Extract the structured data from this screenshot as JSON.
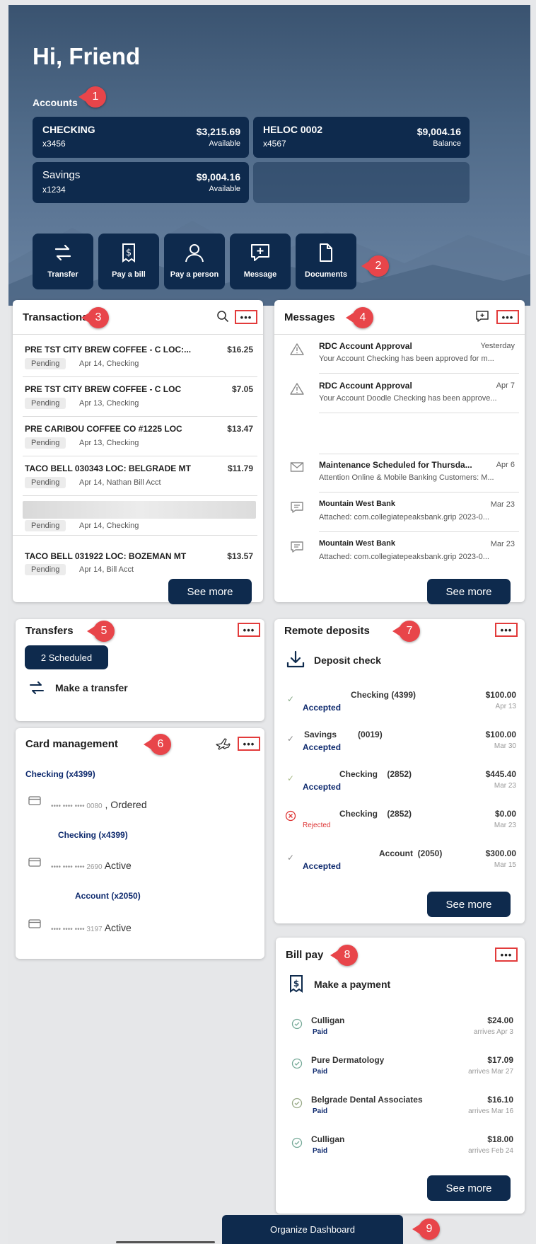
{
  "greeting": "Hi, Friend",
  "accounts_label": "Accounts",
  "accounts": [
    {
      "name": "CHECKING",
      "number": "x3456",
      "amount": "$3,215.69",
      "sub": "Available"
    },
    {
      "name": "HELOC 0002",
      "number": "x4567",
      "amount": "$9,004.16",
      "sub": "Balance"
    },
    {
      "name": "Savings",
      "number": "x1234",
      "amount": "$9,004.16",
      "sub": "Available"
    }
  ],
  "quick_actions": [
    "Transfer",
    "Pay a bill",
    "Pay a person",
    "Message",
    "Documents"
  ],
  "badges": [
    "1",
    "2",
    "3",
    "4",
    "5",
    "6",
    "7",
    "8",
    "9"
  ],
  "more_label": "•••",
  "transactions": {
    "title": "Transactions",
    "items": [
      {
        "desc": "PRE TST CITY BREW COFFEE - C LOC:...",
        "amount": "$16.25",
        "status": "Pending",
        "meta": "Apr 14, Checking"
      },
      {
        "desc": "PRE TST CITY BREW COFFEE - C LOC",
        "amount": "$7.05",
        "status": "Pending",
        "meta": "Apr 13, Checking"
      },
      {
        "desc": "PRE CARIBOU COFFEE CO #1225 LOC",
        "amount": "$13.47",
        "status": "Pending",
        "meta": "Apr 13, Checking"
      },
      {
        "desc": "TACO BELL 030343 LOC: BELGRADE MT",
        "amount": "$11.79",
        "status": "Pending",
        "meta": "Apr 14, Nathan Bill Acct"
      },
      {
        "desc": "",
        "amount": "",
        "status": "Pending",
        "meta": "Apr 14, Checking"
      },
      {
        "desc": "TACO BELL 031922 LOC: BOZEMAN MT",
        "amount": "$13.57",
        "status": "Pending",
        "meta": "Apr 14,        Bill Acct"
      }
    ],
    "see_more": "See more"
  },
  "messages": {
    "title": "Messages",
    "items": [
      {
        "icon": "warning-icon",
        "title": "RDC Account Approval",
        "date": "Yesterday",
        "preview": "Your Account Checking has been approved for m..."
      },
      {
        "icon": "warning-icon",
        "title": "RDC Account Approval",
        "date": "Apr 7",
        "preview": "Your Account Doodle Checking has been approve..."
      },
      {
        "icon": "mail-icon",
        "title": "Maintenance Scheduled for Thursda...",
        "date": "Apr 6",
        "preview": "Attention Online & Mobile Banking Customers: M..."
      },
      {
        "icon": "chat-icon",
        "title": "Mountain West Bank",
        "date": "Mar 23",
        "preview": "Attached: com.collegiatepeaksbank.grip 2023-0..."
      },
      {
        "icon": "chat-icon",
        "title": "Mountain West Bank",
        "date": "Mar 23",
        "preview": "Attached: com.collegiatepeaksbank.grip 2023-0..."
      }
    ],
    "see_more": "See more"
  },
  "transfers": {
    "title": "Transfers",
    "scheduled": "2 Scheduled",
    "make_transfer": "Make a transfer"
  },
  "card_management": {
    "title": "Card management",
    "groups": [
      {
        "account": "Checking (x4399)",
        "card": "•••• •••• •••• 0080",
        "status": "Ordered"
      },
      {
        "account": "Checking (x4399)",
        "card": "•••• •••• •••• 2690",
        "status": "Active"
      },
      {
        "account": "Account (x2050)",
        "card": "•••• •••• •••• 3197",
        "status": "Active"
      }
    ]
  },
  "remote_deposits": {
    "title": "Remote deposits",
    "deposit_check": "Deposit check",
    "items": [
      {
        "account": "Checking (4399)",
        "status": "Accepted",
        "amount": "$100.00",
        "date": "Apr 13"
      },
      {
        "account": "Savings         (0019)",
        "status": "Accepted",
        "amount": "$100.00",
        "date": "Mar 30"
      },
      {
        "account": "Checking    (2852)",
        "status": "Accepted",
        "amount": "$445.40",
        "date": "Mar 23"
      },
      {
        "account": "Checking    (2852)",
        "status": "Rejected",
        "amount": "$0.00",
        "date": "Mar 23"
      },
      {
        "account": "Account  (2050)",
        "status": "Accepted",
        "amount": "$300.00",
        "date": "Mar 15"
      }
    ],
    "see_more": "See more"
  },
  "bill_pay": {
    "title": "Bill pay",
    "make_payment": "Make a payment",
    "items": [
      {
        "payee": "Culligan",
        "status": "Paid",
        "amount": "$24.00",
        "date": "arrives Apr 3"
      },
      {
        "payee": "Pure Dermatology",
        "status": "Paid",
        "amount": "$17.09",
        "date": "arrives Mar 27"
      },
      {
        "payee": "Belgrade Dental Associates",
        "status": "Paid",
        "amount": "$16.10",
        "date": "arrives Mar 16"
      },
      {
        "payee": "Culligan",
        "status": "Paid",
        "amount": "$18.00",
        "date": "arrives Feb 24"
      }
    ],
    "see_more": "See more"
  },
  "organize_dashboard": "Organize Dashboard",
  "colors": {
    "navy": "#0e2a4d",
    "badge": "#e8454a",
    "link": "#0e2a6e",
    "reject": "#d33"
  }
}
